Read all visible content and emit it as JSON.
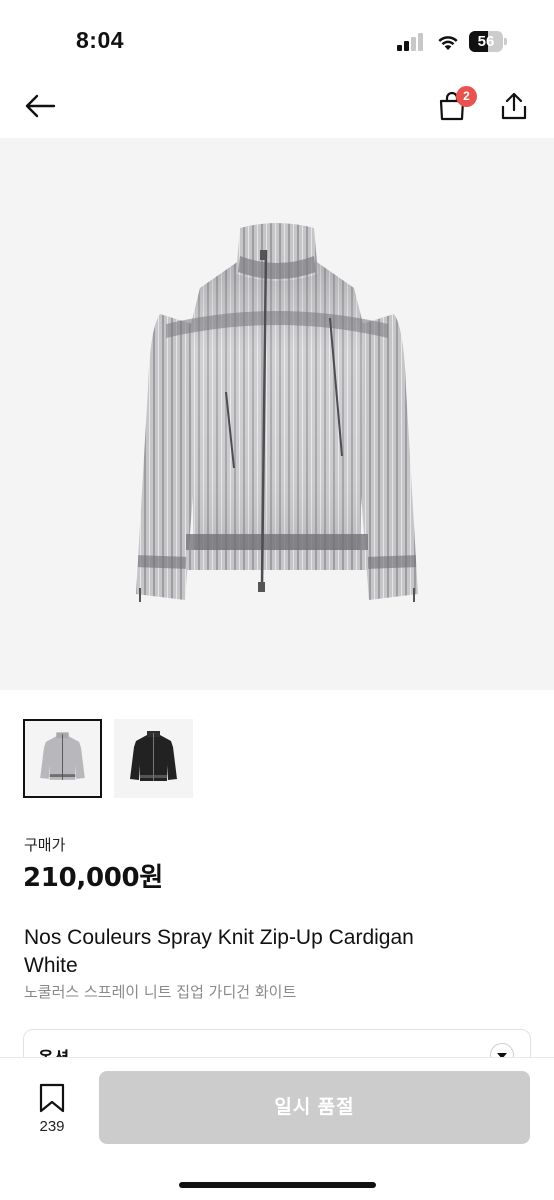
{
  "status_bar": {
    "time": "8:04",
    "battery_level": "56",
    "icons": [
      "cellular-signal-icon",
      "wifi-icon",
      "battery-icon"
    ]
  },
  "nav": {
    "icons": [
      "back-arrow-icon",
      "shopping-bag-icon",
      "share-icon"
    ],
    "cart_count": "2",
    "badge_color": "#e8524f"
  },
  "gallery": {
    "image_count": 2,
    "selected_index": 0,
    "thumbnails": [
      "white-cardigan-thumbnail",
      "black-cardigan-thumbnail"
    ]
  },
  "product": {
    "price_label": "구매가",
    "price": "210,000원",
    "title": "Nos Couleurs Spray Knit Zip-Up Cardigan White",
    "subtitle": "노쿨러스 스프레이 니트 집업 가디건 화이트"
  },
  "option": {
    "label": "옵션"
  },
  "bottom_bar": {
    "wish_count": "239",
    "buy_button_label": "일시 품절",
    "buy_button_color": "#cccccc"
  }
}
